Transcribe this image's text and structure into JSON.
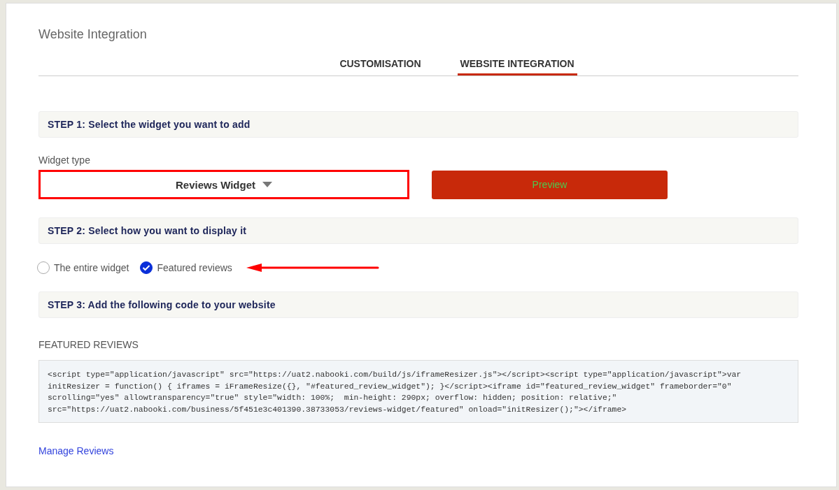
{
  "title": "Website Integration",
  "tabs": [
    {
      "label": "CUSTOMISATION",
      "selected": false
    },
    {
      "label": "WEBSITE INTEGRATION",
      "selected": true
    }
  ],
  "step1": {
    "heading": "STEP 1: Select the widget you want to add",
    "widget_type_label": "Widget type",
    "dropdown": {
      "value": "Reviews Widget",
      "highlighted": true
    },
    "preview_button": "Preview"
  },
  "step2": {
    "heading": "STEP 2: Select how you want to display it",
    "options": [
      {
        "label": "The entire widget",
        "selected": false,
        "arrow": false
      },
      {
        "label": "Featured reviews",
        "selected": true,
        "arrow": true
      }
    ]
  },
  "step3": {
    "heading": "STEP 3: Add the following code to your website",
    "code_label": "FEATURED REVIEWS",
    "code_lines": [
      "<script type=\"application/javascript\" src=\"https://uat2.nabooki.com/build/js/iframeResizer.js\"></script><script type=\"application/javascript\">var",
      "initResizer = function() { iframes = iFrameResize({}, \"#featured_review_widget\"); }</script><iframe id=\"featured_review_widget\" frameborder=\"0\"",
      "scrolling=\"yes\" allowtransparency=\"true\" style=\"width: 100%;  min-height: 290px; overflow: hidden; position: relative;\"",
      "src=\"https://uat2.nabooki.com/business/5f451e3c401390.38733053/reviews-widget/featured\" onload=\"initResizer();\"></iframe>"
    ]
  },
  "link": "Manage Reviews"
}
